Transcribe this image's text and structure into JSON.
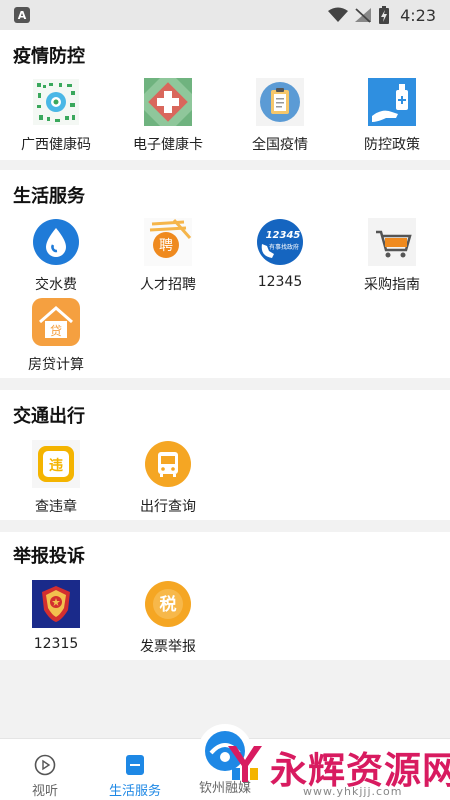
{
  "status_bar": {
    "time": "4:23",
    "app_badge": "A"
  },
  "sections": [
    {
      "title": "疫情防控",
      "items": [
        {
          "label": "广西健康码",
          "icon": "qr-code-icon"
        },
        {
          "label": "电子健康卡",
          "icon": "health-card-icon"
        },
        {
          "label": "全国疫情",
          "icon": "clipboard-icon"
        },
        {
          "label": "防控政策",
          "icon": "sanitizer-icon"
        }
      ]
    },
    {
      "title": "生活服务",
      "items": [
        {
          "label": "交水费",
          "icon": "water-drop-icon"
        },
        {
          "label": "人才招聘",
          "icon": "recruit-icon"
        },
        {
          "label": "12345",
          "icon": "hotline-icon"
        },
        {
          "label": "采购指南",
          "icon": "shopping-cart-icon"
        },
        {
          "label": "房贷计算",
          "icon": "house-loan-icon"
        }
      ]
    },
    {
      "title": "交通出行",
      "items": [
        {
          "label": "查违章",
          "icon": "violation-icon"
        },
        {
          "label": "出行查询",
          "icon": "bus-icon"
        }
      ]
    },
    {
      "title": "举报投诉",
      "items": [
        {
          "label": "12315",
          "icon": "emblem-icon"
        },
        {
          "label": "发票举报",
          "icon": "tax-icon"
        }
      ]
    }
  ],
  "icon_texts": {
    "hotline": "12345",
    "hotline_sub": "有事找政府",
    "recruit": "聘",
    "loan": "贷",
    "violation": "违",
    "tax": "税"
  },
  "bottom_nav": [
    {
      "label": "视听",
      "active": false
    },
    {
      "label": "生活服务",
      "active": true
    },
    {
      "label": "钦州融媒",
      "active": false
    }
  ],
  "watermark": {
    "text": "永辉资源网",
    "url": "www.yhkjjj.com"
  },
  "colors": {
    "accent": "#1e88e5",
    "watermark": "#d81b60",
    "orange": "#f5a623"
  }
}
